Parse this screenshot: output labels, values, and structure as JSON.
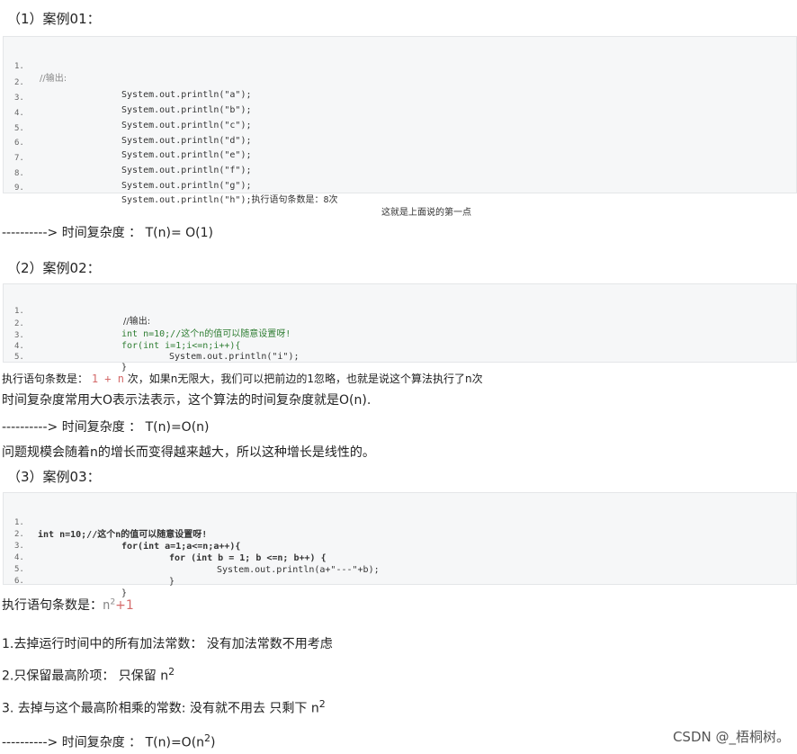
{
  "case1": {
    "heading": "（1）案例01：",
    "lines": [
      {
        "n": "1.",
        "text": "//输出:"
      },
      {
        "n": "2.",
        "text": "System.out.println(\"a\");"
      },
      {
        "n": "3.",
        "text": "System.out.println(\"b\");"
      },
      {
        "n": "4.",
        "text": "System.out.println(\"c\");"
      },
      {
        "n": "5.",
        "text": "System.out.println(\"d\");"
      },
      {
        "n": "6.",
        "text": "System.out.println(\"e\");"
      },
      {
        "n": "7.",
        "text": "System.out.println(\"f\");"
      },
      {
        "n": "8.",
        "text": "System.out.println(\"g\");"
      },
      {
        "n": "9.",
        "text": "System.out.println(\"h\");执行语句条数是：8次"
      }
    ],
    "line9_note": "这就是上面说的第一点",
    "result": "----------> 时间复杂度 ：  T(n)= O(1)"
  },
  "case2": {
    "heading": "（2）案例02：",
    "lines": [
      {
        "n": "1.",
        "text": "//输出:"
      },
      {
        "n": "2.",
        "text": "int n=10;//这个n的值可以随意设置呀!"
      },
      {
        "n": "3.",
        "text": "for(int i=1;i<=n;i++){"
      },
      {
        "n": "4.",
        "text": "System.out.println(\"i\");"
      },
      {
        "n": "5.",
        "text": "}"
      }
    ],
    "para1_prefix": "执行语句条数是：",
    "para1_expr": "1 + n",
    "para1_suffix": "次，如果n无限大，我们可以把前边的1忽略，也就是说这个算法执行了n次",
    "para2": "时间复杂度常用大O表示法表示，这个算法的时间复杂度就是O(n).",
    "result": "----------> 时间复杂度 ：  T(n)=O(n)",
    "para3": "问题规模会随着n的增长而变得越来越大，所以这种增长是线性的。"
  },
  "case3": {
    "heading": "（3）案例03：",
    "lines": [
      {
        "n": "1.",
        "text": "int n=10;//这个n的值可以随意设置呀!"
      },
      {
        "n": "2.",
        "text": "for(int a=1;a<=n;a++){"
      },
      {
        "n": "3.",
        "text": "for (int b = 1; b <=n; b++) {"
      },
      {
        "n": "4.",
        "text": "System.out.println(a+\"---\"+b);"
      },
      {
        "n": "5.",
        "text": "}"
      },
      {
        "n": "6.",
        "text": "}"
      }
    ],
    "count_label": "执行语句条数是：",
    "count_base": "n",
    "count_exp": "2",
    "count_tail": "+1",
    "step1": "1.去掉运行时间中的所有加法常数：  没有加法常数不用考虑",
    "step2_text": "2.只保留最高阶项：  只保留 n",
    "step2_exp": "2",
    "step3_text": "3. 去掉与这个最高阶相乘的常数: 没有就不用去    只剩下 n",
    "step3_exp": "2",
    "result_text": "----------> 时间复杂度 ：  T(n)=O(n",
    "result_exp": "2",
    "result_close": ")"
  },
  "watermark": "CSDN @_梧桐树。"
}
